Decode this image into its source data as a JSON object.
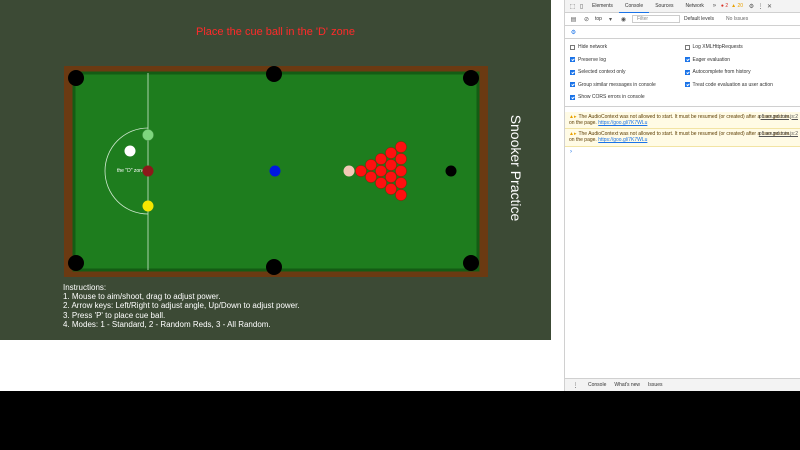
{
  "game": {
    "banner": "Place the cue ball in the 'D' zone",
    "side_title": "Snooker Practice",
    "d_zone_label": "the \"D\" zone",
    "instructions": [
      "Instructions:",
      "1. Mouse to aim/shoot, drag to adjust power.",
      "2. Arrow keys: Left/Right to adjust angle, Up/Down to adjust power.",
      "3. Press 'P' to place cue ball.",
      "4. Modes: 1 - Standard, 2 - Random Reds, 3 - All Random."
    ],
    "colors": {
      "panel": "#3c4a35",
      "cloth": "#1e7d1e",
      "cushion": "#6b3a12",
      "banner": "#ff2a2a"
    }
  },
  "devtools": {
    "tabs": [
      "Elements",
      "Console",
      "Sources",
      "Network"
    ],
    "active_tab": "Console",
    "error_count": "2",
    "warning_count": "20",
    "context": "top",
    "filter_placeholder": "Filter",
    "levels": "Default levels",
    "issues": "No Issues",
    "settings_left": [
      {
        "label": "Hide network",
        "checked": false
      },
      {
        "label": "Preserve log",
        "checked": true
      },
      {
        "label": "Selected context only",
        "checked": true
      },
      {
        "label": "Group similar messages in console",
        "checked": true
      },
      {
        "label": "Show CORS errors in console",
        "checked": true
      }
    ],
    "settings_right": [
      {
        "label": "Log XMLHttpRequests",
        "checked": false
      },
      {
        "label": "Eager evaluation",
        "checked": true
      },
      {
        "label": "Autocomplete from history",
        "checked": true
      },
      {
        "label": "Treat code evaluation as user action",
        "checked": true
      }
    ],
    "messages": [
      {
        "text": "The AudioContext was not allowed to start. It must be resumed (or created) after a user gesture on the page.",
        "link": "https://goo.gl/7K7WLu",
        "source": "p5.sound.min.js:2"
      },
      {
        "text": "The AudioContext was not allowed to start. It must be resumed (or created) after a user gesture on the page.",
        "link": "https://goo.gl/7K7WLu",
        "source": "p5.sound.min.js:2"
      }
    ],
    "drawer_tabs": [
      "Console",
      "What's new",
      "Issues"
    ]
  }
}
